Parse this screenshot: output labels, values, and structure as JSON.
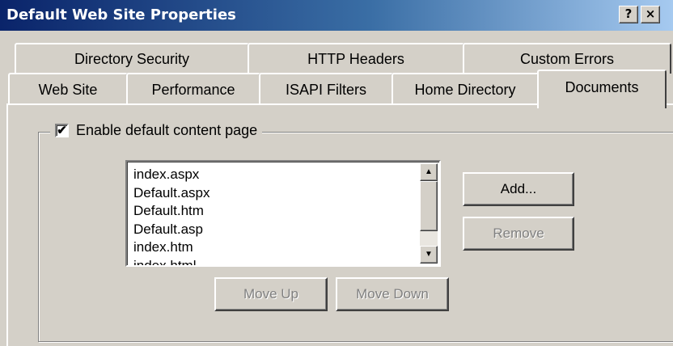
{
  "window": {
    "title": "Default Web Site Properties",
    "help_button": "?",
    "close_button": "×"
  },
  "tabs_row1": [
    "Directory Security",
    "HTTP Headers",
    "Custom Errors"
  ],
  "tabs_row2": [
    "Web Site",
    "Performance",
    "ISAPI Filters",
    "Home Directory",
    "Documents"
  ],
  "active_tab": "Documents",
  "documents": {
    "enable_default_label": "Enable default content page",
    "enable_default_checked": true,
    "default_pages": [
      "index.aspx",
      "Default.aspx",
      "Default.htm",
      "Default.asp",
      "index.htm",
      "index.html"
    ],
    "buttons": {
      "add": "Add...",
      "remove": "Remove",
      "move_up": "Move Up",
      "move_down": "Move Down"
    }
  },
  "icons": {
    "check": "✔",
    "scroll_up": "▲",
    "scroll_down": "▼"
  }
}
